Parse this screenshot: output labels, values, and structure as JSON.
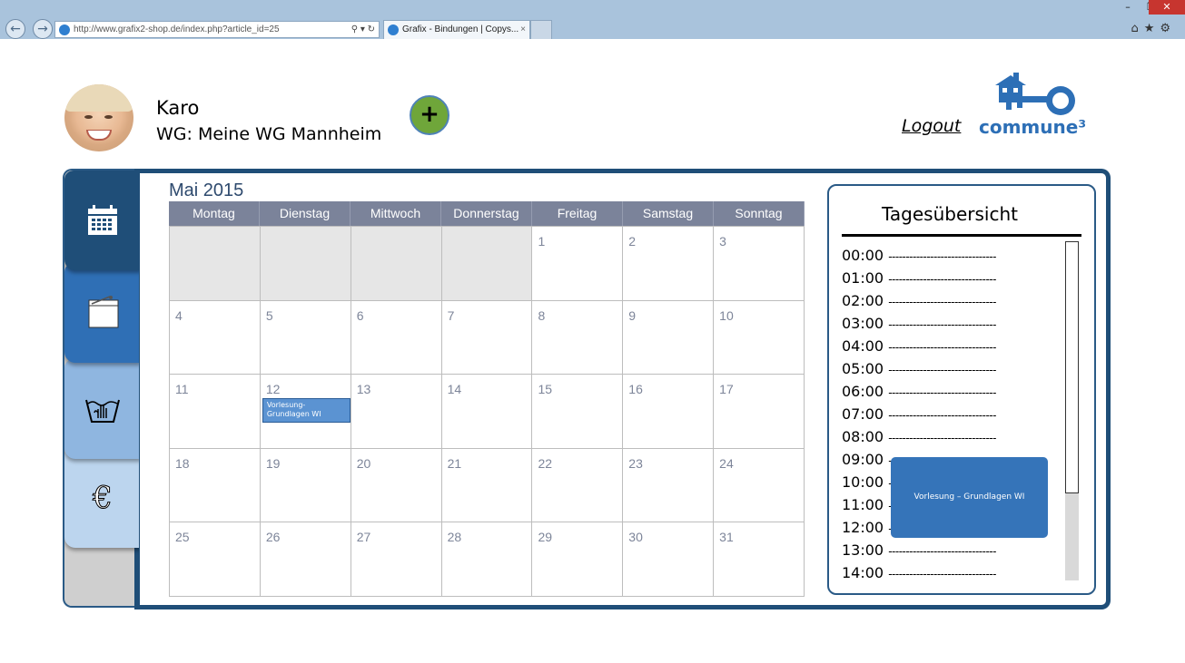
{
  "browser": {
    "url": "http://www.grafix2-shop.de/index.php?article_id=25",
    "tab_title": "Grafix - Bindungen | Copys...",
    "tab_close": "×",
    "back_icon": "arrow-left-icon",
    "forward_icon": "arrow-right-icon",
    "window_controls": [
      "–",
      "❐",
      "✕"
    ],
    "tool_icons": "⌂★⚙"
  },
  "user": {
    "name": "Karo",
    "wg": "WG: Meine WG Mannheim"
  },
  "header": {
    "add_label": "+",
    "logout_label": "Logout",
    "logo_text": "commune³"
  },
  "sidebar": {
    "items": [
      {
        "name": "calendar",
        "icon": "calendar-icon",
        "color": "#1f4e78",
        "active": true
      },
      {
        "name": "notes",
        "icon": "notepad-icon",
        "color": "#2f6fb5",
        "active": false
      },
      {
        "name": "laundry",
        "icon": "washing-icon",
        "color": "#8fb6e0",
        "active": false
      },
      {
        "name": "finance",
        "icon": "euro-icon",
        "color": "#bcd5ee",
        "active": false
      }
    ]
  },
  "calendar": {
    "title": "Mai 2015",
    "weekdays": [
      "Montag",
      "Dienstag",
      "Mittwoch",
      "Donnerstag",
      "Freitag",
      "Samstag",
      "Sonntag"
    ],
    "weeks": [
      [
        "",
        "",
        "",
        "",
        "1",
        "2",
        "3"
      ],
      [
        "4",
        "5",
        "6",
        "7",
        "8",
        "9",
        "10"
      ],
      [
        "11",
        "12",
        "13",
        "14",
        "15",
        "16",
        "17"
      ],
      [
        "18",
        "19",
        "20",
        "21",
        "22",
        "23",
        "24"
      ],
      [
        "25",
        "26",
        "27",
        "28",
        "29",
        "30",
        "31"
      ]
    ],
    "event": {
      "day": "12",
      "title": "Vorlesung- Grundlagen WI"
    }
  },
  "day_overview": {
    "title": "Tagesübersicht",
    "times": [
      "00:00",
      "01:00",
      "02:00",
      "03:00",
      "04:00",
      "05:00",
      "06:00",
      "07:00",
      "08:00",
      "09:00",
      "10:00",
      "11:00",
      "12:00",
      "13:00",
      "14:00"
    ],
    "dashes": "-------------------------------",
    "event_label": "Vorlesung – Grundlagen WI"
  },
  "colors": {
    "chrome": "#a9c3dc",
    "frame": "#1f4e78",
    "calendar_header": "#7b839a",
    "event": "#3574b9",
    "add_button": "#6fa63a"
  }
}
